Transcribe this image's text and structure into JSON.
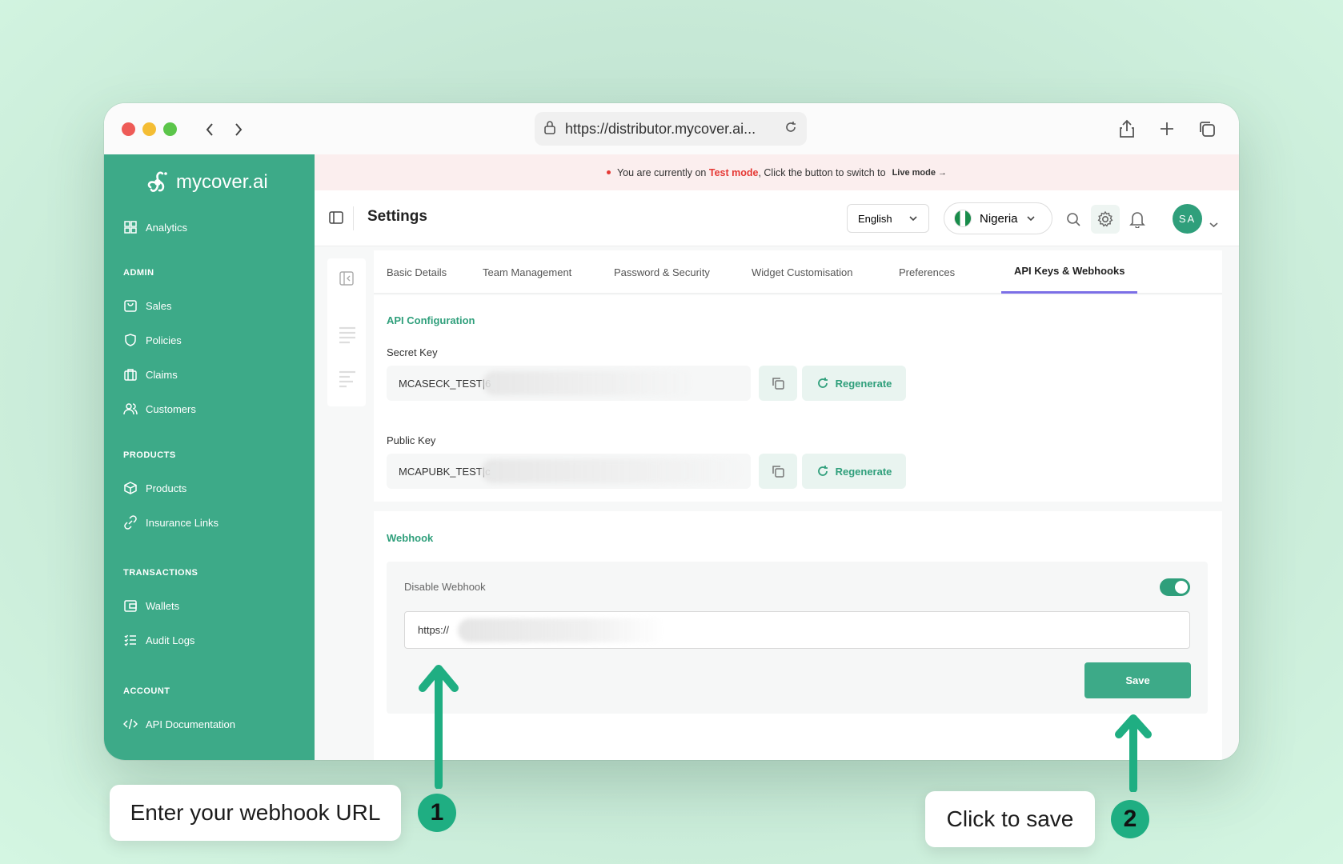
{
  "browser": {
    "url": "https://distributor.mycover.ai..."
  },
  "sidebar": {
    "logo": "mycover.ai",
    "items": [
      {
        "label": "Analytics",
        "icon": "grid-icon"
      },
      {
        "section": "ADMIN"
      },
      {
        "label": "Sales",
        "icon": "bag-icon"
      },
      {
        "label": "Policies",
        "icon": "shield-icon"
      },
      {
        "label": "Claims",
        "icon": "briefcase-icon"
      },
      {
        "label": "Customers",
        "icon": "users-icon"
      },
      {
        "section": "PRODUCTS"
      },
      {
        "label": "Products",
        "icon": "box-icon"
      },
      {
        "label": "Insurance Links",
        "icon": "link-icon"
      },
      {
        "section": "TRANSACTIONS"
      },
      {
        "label": "Wallets",
        "icon": "wallet-icon"
      },
      {
        "label": "Audit Logs",
        "icon": "list-icon"
      },
      {
        "section": "ACCOUNT"
      },
      {
        "label": "API Documentation",
        "icon": "code-icon"
      }
    ]
  },
  "banner": {
    "prefix": "You are currently on",
    "mode": "Test mode",
    "suffix": ", Click the button to switch to",
    "live": "Live mode →"
  },
  "header": {
    "title": "Settings",
    "language": "English",
    "country": "Nigeria",
    "avatar": "SA"
  },
  "tabs": [
    "Basic Details",
    "Team Management",
    "Password & Security",
    "Widget Customisation",
    "Preferences",
    "API Keys & Webhooks"
  ],
  "api": {
    "section_title": "API Configuration",
    "secret_label": "Secret Key",
    "secret_value": "MCASECK_TEST|6",
    "public_label": "Public Key",
    "public_value": "MCAPUBK_TEST|c",
    "regenerate": "Regenerate"
  },
  "webhook": {
    "section_title": "Webhook",
    "toggle_label": "Disable Webhook",
    "toggle_on": true,
    "url_value": "https://",
    "save": "Save"
  },
  "callouts": {
    "one_text": "Enter your webhook URL",
    "one_num": "1",
    "two_text": "Click to save",
    "two_num": "2"
  },
  "colors": {
    "brand": "#3daa88",
    "accent_tab": "#7b6fe6",
    "test_mode": "#e53935"
  }
}
